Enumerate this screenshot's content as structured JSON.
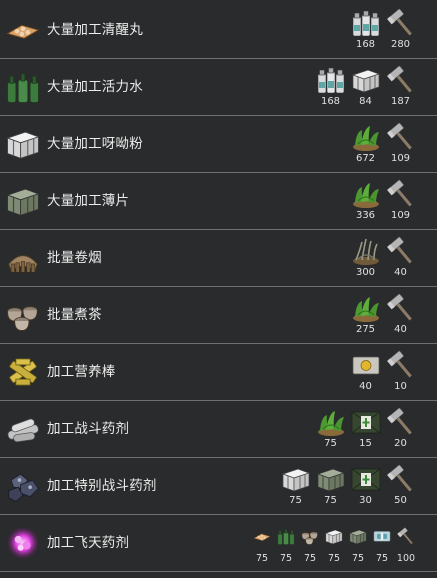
{
  "recipes": [
    {
      "label": "大量加工清醒丸",
      "icon": "pill-tray-icon",
      "costs": [
        {
          "icon": "medicine-bottles-icon",
          "value": "168"
        },
        {
          "icon": "hammer-icon",
          "value": "280"
        }
      ]
    },
    {
      "label": "大量加工活力水",
      "icon": "green-bottles-icon",
      "costs": [
        {
          "icon": "medicine-bottles-icon",
          "value": "168"
        },
        {
          "icon": "white-crate-icon",
          "value": "84"
        },
        {
          "icon": "hammer-icon",
          "value": "187"
        }
      ]
    },
    {
      "label": "大量加工呀呦粉",
      "icon": "white-crate-icon",
      "costs": [
        {
          "icon": "green-plant-icon",
          "value": "672"
        },
        {
          "icon": "hammer-icon",
          "value": "109"
        }
      ]
    },
    {
      "label": "大量加工薄片",
      "icon": "green-crate-icon",
      "costs": [
        {
          "icon": "green-plant-icon",
          "value": "336"
        },
        {
          "icon": "hammer-icon",
          "value": "109"
        }
      ]
    },
    {
      "label": "批量卷烟",
      "icon": "rolled-leaves-icon",
      "costs": [
        {
          "icon": "dry-plant-icon",
          "value": "300"
        },
        {
          "icon": "hammer-icon",
          "value": "40"
        }
      ]
    },
    {
      "label": "批量煮茶",
      "icon": "tea-bowls-icon",
      "costs": [
        {
          "icon": "green-plant-icon",
          "value": "275"
        },
        {
          "icon": "hammer-icon",
          "value": "40"
        }
      ]
    },
    {
      "label": "加工营养棒",
      "icon": "nutrition-bars-icon",
      "costs": [
        {
          "icon": "gold-chip-icon",
          "value": "40"
        },
        {
          "icon": "hammer-icon",
          "value": "10"
        }
      ]
    },
    {
      "label": "加工战斗药剂",
      "icon": "silver-syringe-icon",
      "costs": [
        {
          "icon": "green-plant-icon",
          "value": "75"
        },
        {
          "icon": "medkit-icon",
          "value": "15"
        },
        {
          "icon": "hammer-icon",
          "value": "20"
        }
      ]
    },
    {
      "label": "加工特别战斗药剂",
      "icon": "blue-crystal-icon",
      "costs": [
        {
          "icon": "white-crate-icon",
          "value": "75"
        },
        {
          "icon": "green-crate-icon",
          "value": "75"
        },
        {
          "icon": "medkit-icon",
          "value": "30"
        },
        {
          "icon": "hammer-icon",
          "value": "50"
        }
      ]
    },
    {
      "label": "加工飞天药剂",
      "icon": "glowing-orb-icon",
      "costs": [
        {
          "icon": "pill-tray-icon",
          "value": "75"
        },
        {
          "icon": "green-bottles-icon",
          "value": "75"
        },
        {
          "icon": "tea-bowls-icon",
          "value": "75"
        },
        {
          "icon": "white-crate-icon",
          "value": "75"
        },
        {
          "icon": "green-crate-icon",
          "value": "75"
        },
        {
          "icon": "blue-vial-icon",
          "value": "75"
        },
        {
          "icon": "hammer-icon",
          "value": "100"
        }
      ]
    }
  ]
}
